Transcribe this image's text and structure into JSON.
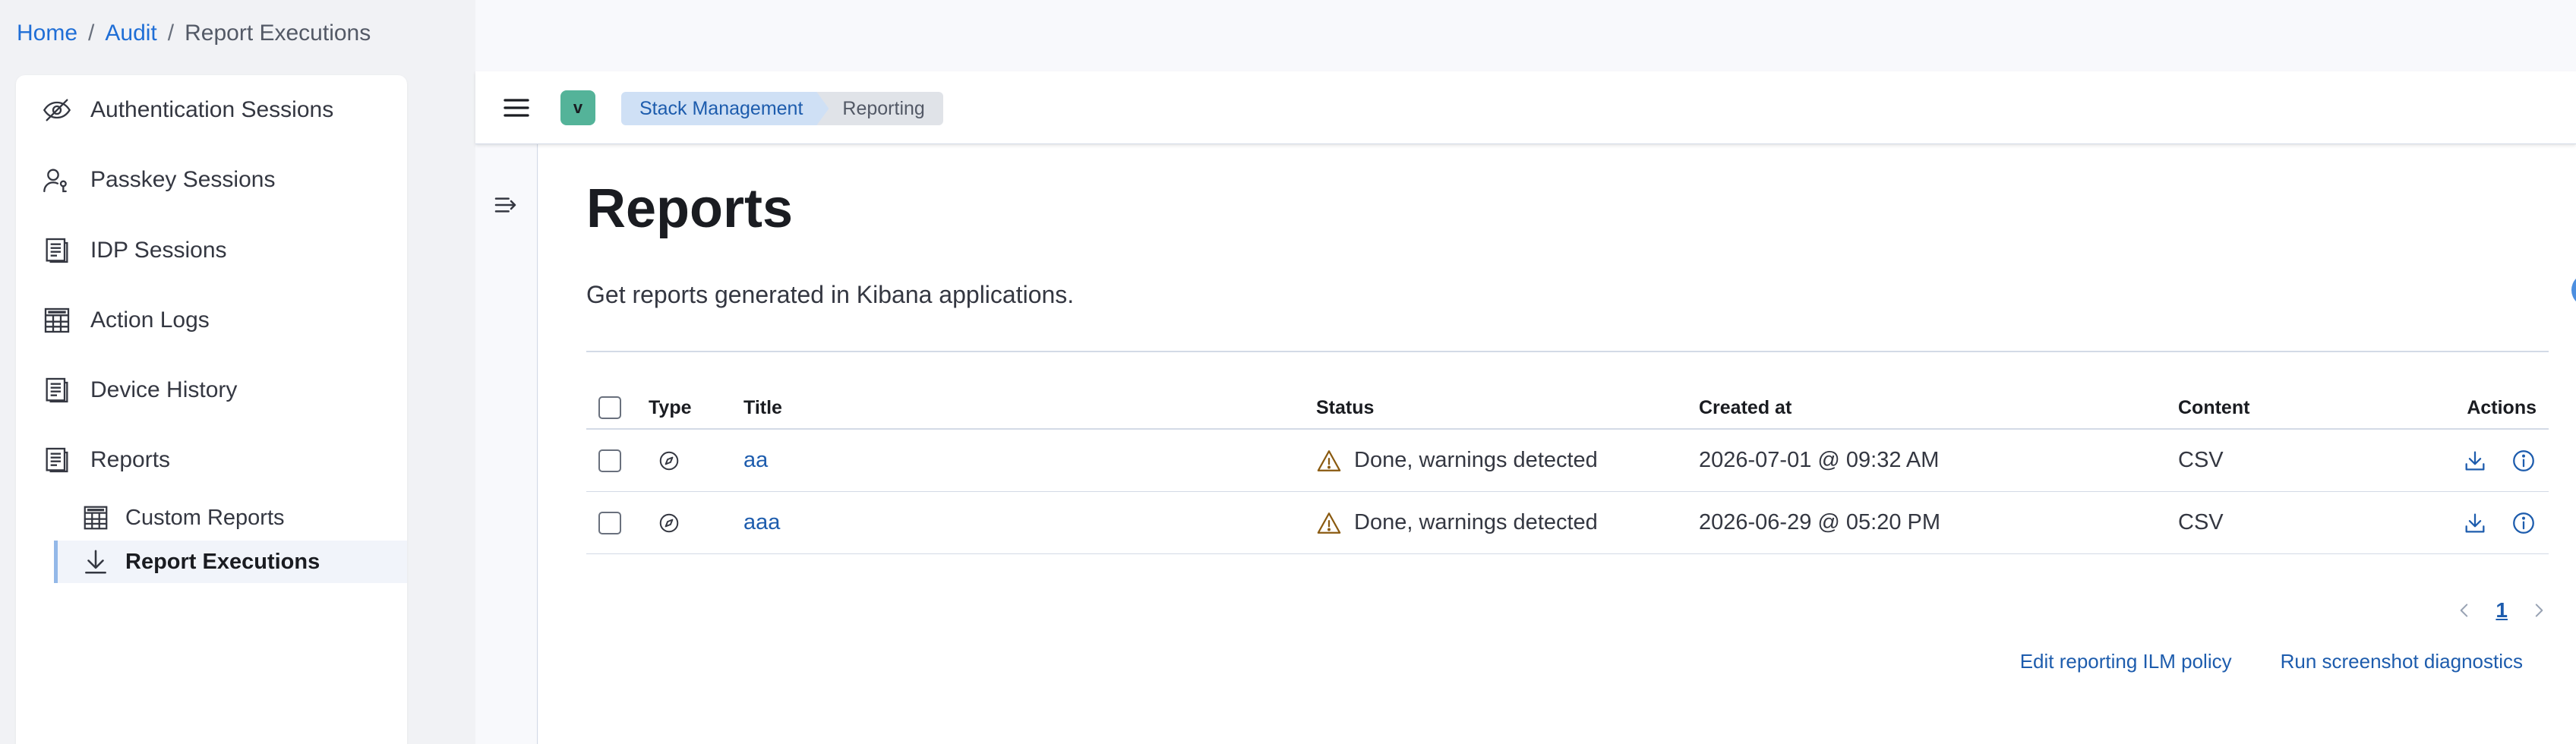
{
  "breadcrumb": {
    "home": "Home",
    "audit": "Audit",
    "current": "Report Executions",
    "separator": "/"
  },
  "sidebar": {
    "items": [
      {
        "label": "Authentication Sessions",
        "icon": "eye-closed-icon"
      },
      {
        "label": "Passkey Sessions",
        "icon": "user-key-icon"
      },
      {
        "label": "IDP Sessions",
        "icon": "document-list-icon"
      },
      {
        "label": "Action Logs",
        "icon": "table-icon"
      },
      {
        "label": "Device History",
        "icon": "document-list-icon"
      },
      {
        "label": "Reports",
        "icon": "document-list-icon"
      }
    ],
    "sub_items": [
      {
        "label": "Custom Reports",
        "icon": "table-icon"
      },
      {
        "label": "Report Executions",
        "icon": "download-icon",
        "active": true
      }
    ]
  },
  "topbar": {
    "space_initial": "v",
    "crumbs": [
      "Stack Management",
      "Reporting"
    ]
  },
  "page": {
    "title": "Reports",
    "description": "Get reports generated in Kibana applications."
  },
  "table": {
    "headers": {
      "type": "Type",
      "title": "Title",
      "status": "Status",
      "created": "Created at",
      "content": "Content",
      "actions": "Actions"
    },
    "rows": [
      {
        "title": "aa",
        "status": "Done, warnings detected",
        "created": "2026-07-01 @ 09:32 AM",
        "content": "CSV"
      },
      {
        "title": "aaa",
        "status": "Done, warnings detected",
        "created": "2026-06-29 @ 05:20 PM",
        "content": "CSV"
      }
    ]
  },
  "pagination": {
    "current_page": "1"
  },
  "footer": {
    "edit_policy": "Edit reporting ILM policy",
    "run_diagnostics": "Run screenshot diagnostics"
  },
  "colors": {
    "link": "#1d5cad",
    "breadcrumb_link": "#1f6ed6",
    "space_avatar": "#54b399",
    "warning": "#b5761d",
    "active_border": "#93b8e8"
  }
}
